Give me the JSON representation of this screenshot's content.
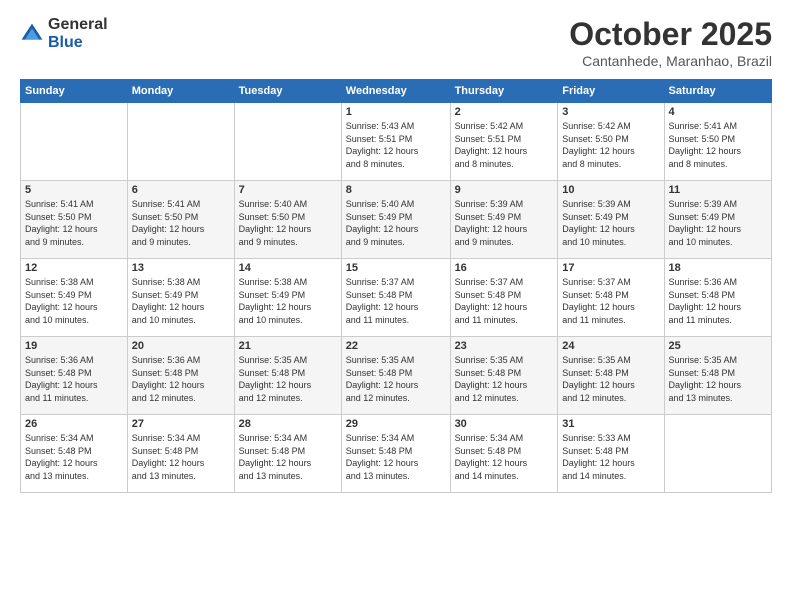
{
  "header": {
    "logo_general": "General",
    "logo_blue": "Blue",
    "month_title": "October 2025",
    "location": "Cantanhede, Maranhao, Brazil"
  },
  "days_of_week": [
    "Sunday",
    "Monday",
    "Tuesday",
    "Wednesday",
    "Thursday",
    "Friday",
    "Saturday"
  ],
  "weeks": [
    [
      {
        "day": "",
        "info": ""
      },
      {
        "day": "",
        "info": ""
      },
      {
        "day": "",
        "info": ""
      },
      {
        "day": "1",
        "info": "Sunrise: 5:43 AM\nSunset: 5:51 PM\nDaylight: 12 hours\nand 8 minutes."
      },
      {
        "day": "2",
        "info": "Sunrise: 5:42 AM\nSunset: 5:51 PM\nDaylight: 12 hours\nand 8 minutes."
      },
      {
        "day": "3",
        "info": "Sunrise: 5:42 AM\nSunset: 5:50 PM\nDaylight: 12 hours\nand 8 minutes."
      },
      {
        "day": "4",
        "info": "Sunrise: 5:41 AM\nSunset: 5:50 PM\nDaylight: 12 hours\nand 8 minutes."
      }
    ],
    [
      {
        "day": "5",
        "info": "Sunrise: 5:41 AM\nSunset: 5:50 PM\nDaylight: 12 hours\nand 9 minutes."
      },
      {
        "day": "6",
        "info": "Sunrise: 5:41 AM\nSunset: 5:50 PM\nDaylight: 12 hours\nand 9 minutes."
      },
      {
        "day": "7",
        "info": "Sunrise: 5:40 AM\nSunset: 5:50 PM\nDaylight: 12 hours\nand 9 minutes."
      },
      {
        "day": "8",
        "info": "Sunrise: 5:40 AM\nSunset: 5:49 PM\nDaylight: 12 hours\nand 9 minutes."
      },
      {
        "day": "9",
        "info": "Sunrise: 5:39 AM\nSunset: 5:49 PM\nDaylight: 12 hours\nand 9 minutes."
      },
      {
        "day": "10",
        "info": "Sunrise: 5:39 AM\nSunset: 5:49 PM\nDaylight: 12 hours\nand 10 minutes."
      },
      {
        "day": "11",
        "info": "Sunrise: 5:39 AM\nSunset: 5:49 PM\nDaylight: 12 hours\nand 10 minutes."
      }
    ],
    [
      {
        "day": "12",
        "info": "Sunrise: 5:38 AM\nSunset: 5:49 PM\nDaylight: 12 hours\nand 10 minutes."
      },
      {
        "day": "13",
        "info": "Sunrise: 5:38 AM\nSunset: 5:49 PM\nDaylight: 12 hours\nand 10 minutes."
      },
      {
        "day": "14",
        "info": "Sunrise: 5:38 AM\nSunset: 5:49 PM\nDaylight: 12 hours\nand 10 minutes."
      },
      {
        "day": "15",
        "info": "Sunrise: 5:37 AM\nSunset: 5:48 PM\nDaylight: 12 hours\nand 11 minutes."
      },
      {
        "day": "16",
        "info": "Sunrise: 5:37 AM\nSunset: 5:48 PM\nDaylight: 12 hours\nand 11 minutes."
      },
      {
        "day": "17",
        "info": "Sunrise: 5:37 AM\nSunset: 5:48 PM\nDaylight: 12 hours\nand 11 minutes."
      },
      {
        "day": "18",
        "info": "Sunrise: 5:36 AM\nSunset: 5:48 PM\nDaylight: 12 hours\nand 11 minutes."
      }
    ],
    [
      {
        "day": "19",
        "info": "Sunrise: 5:36 AM\nSunset: 5:48 PM\nDaylight: 12 hours\nand 11 minutes."
      },
      {
        "day": "20",
        "info": "Sunrise: 5:36 AM\nSunset: 5:48 PM\nDaylight: 12 hours\nand 12 minutes."
      },
      {
        "day": "21",
        "info": "Sunrise: 5:35 AM\nSunset: 5:48 PM\nDaylight: 12 hours\nand 12 minutes."
      },
      {
        "day": "22",
        "info": "Sunrise: 5:35 AM\nSunset: 5:48 PM\nDaylight: 12 hours\nand 12 minutes."
      },
      {
        "day": "23",
        "info": "Sunrise: 5:35 AM\nSunset: 5:48 PM\nDaylight: 12 hours\nand 12 minutes."
      },
      {
        "day": "24",
        "info": "Sunrise: 5:35 AM\nSunset: 5:48 PM\nDaylight: 12 hours\nand 12 minutes."
      },
      {
        "day": "25",
        "info": "Sunrise: 5:35 AM\nSunset: 5:48 PM\nDaylight: 12 hours\nand 13 minutes."
      }
    ],
    [
      {
        "day": "26",
        "info": "Sunrise: 5:34 AM\nSunset: 5:48 PM\nDaylight: 12 hours\nand 13 minutes."
      },
      {
        "day": "27",
        "info": "Sunrise: 5:34 AM\nSunset: 5:48 PM\nDaylight: 12 hours\nand 13 minutes."
      },
      {
        "day": "28",
        "info": "Sunrise: 5:34 AM\nSunset: 5:48 PM\nDaylight: 12 hours\nand 13 minutes."
      },
      {
        "day": "29",
        "info": "Sunrise: 5:34 AM\nSunset: 5:48 PM\nDaylight: 12 hours\nand 13 minutes."
      },
      {
        "day": "30",
        "info": "Sunrise: 5:34 AM\nSunset: 5:48 PM\nDaylight: 12 hours\nand 14 minutes."
      },
      {
        "day": "31",
        "info": "Sunrise: 5:33 AM\nSunset: 5:48 PM\nDaylight: 12 hours\nand 14 minutes."
      },
      {
        "day": "",
        "info": ""
      }
    ]
  ]
}
